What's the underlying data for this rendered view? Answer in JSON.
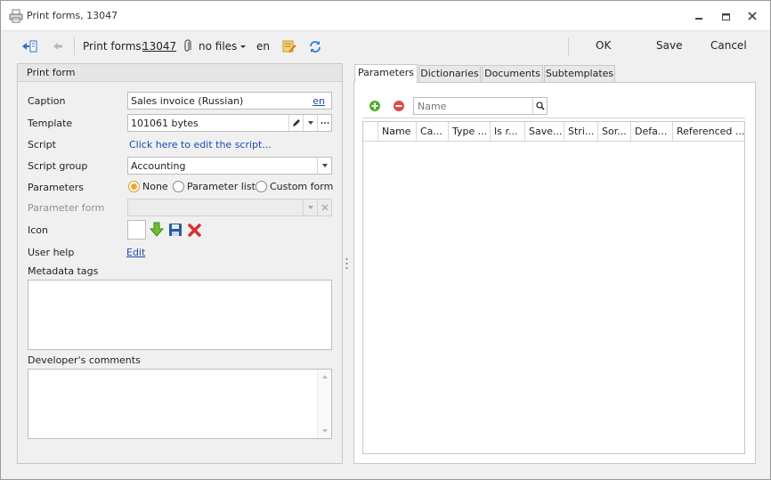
{
  "window": {
    "title": "Print forms, 13047"
  },
  "toolbar": {
    "prefix": "Print forms:",
    "id": "13047",
    "files": "no files",
    "lang": "en",
    "ok": "OK",
    "save": "Save",
    "cancel": "Cancel"
  },
  "form": {
    "header": "Print form",
    "caption_label": "Caption",
    "caption_value": "Sales invoice (Russian)",
    "caption_lang": "en",
    "template_label": "Template",
    "template_value": "101061 bytes",
    "script_label": "Script",
    "script_link": "Click here to edit the script...",
    "script_group_label": "Script group",
    "script_group_value": "Accounting",
    "parameters_label": "Parameters",
    "param_none": "None",
    "param_list": "Parameter list",
    "param_custom": "Custom form",
    "parameter_form_label": "Parameter form",
    "icon_label": "Icon",
    "user_help_label": "User help",
    "user_help_link": "Edit",
    "metadata_label": "Metadata tags",
    "dev_comments_label": "Developer's comments"
  },
  "tabs": [
    "Parameters",
    "Dictionaries",
    "Documents",
    "Subtemplates"
  ],
  "grid": {
    "search_placeholder": "Name",
    "columns": [
      "Name",
      "Ca...",
      "Type ...",
      "Is r...",
      "Save...",
      "Stri...",
      "Sor...",
      "Defa...",
      "Referenced ..."
    ]
  },
  "colors": {
    "accent": "#1a4bb3",
    "radio_checked": "#f0a830"
  }
}
